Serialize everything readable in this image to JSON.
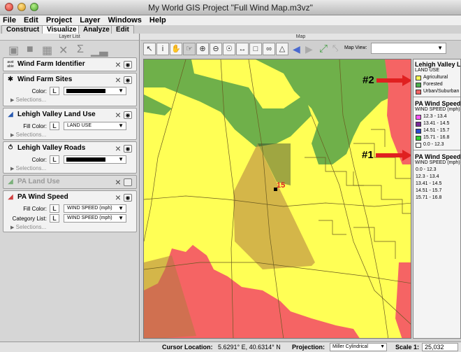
{
  "window": {
    "title": "My World GIS Project \"Full Wind Map.m3vz\""
  },
  "menu": [
    "File",
    "Edit",
    "Project",
    "Layer",
    "Windows",
    "Help"
  ],
  "tabs": [
    {
      "label": "Construct",
      "active": false
    },
    {
      "label": "Visualize",
      "active": true
    },
    {
      "label": "Analyze",
      "active": false
    },
    {
      "label": "Edit",
      "active": false
    }
  ],
  "layer_panel": {
    "title": "Layer List",
    "layers": [
      {
        "name": "Wind Farm Identifier",
        "icon_text": "avst abie"
      },
      {
        "name": "Wind Farm Sites",
        "color_label": "Color:",
        "selections": "Selections..."
      },
      {
        "name": "Lehigh Valley Land Use",
        "fill_label": "Fill Color:",
        "fill_value": "LAND USE",
        "selections": "Selections..."
      },
      {
        "name": "Lehigh Valley Roads",
        "color_label": "Color:",
        "selections": "Selections..."
      },
      {
        "name": "PA Land Use"
      },
      {
        "name": "PA Wind Speed",
        "fill_label": "Fill Color:",
        "fill_value": "WIND SPEED (mph)",
        "category_label": "Category List:",
        "category_value": "WIND SPEED (mph)",
        "selections": "Selections..."
      }
    ],
    "L_label": "L"
  },
  "map_panel": {
    "title": "Map",
    "map_view_label": "Map View:",
    "map_view_value": ""
  },
  "map": {
    "site_label": "15",
    "annotation_1": "#1",
    "annotation_2": "#2",
    "colors": {
      "yellow": "#ffff55",
      "green": "#6fb04a",
      "red": "#f56464",
      "brown": "#c89650",
      "arrow": "#e02020"
    }
  },
  "legend": {
    "land_use": {
      "title": "Lehigh Valley Land Use",
      "subtitle": "LAND USE",
      "items": [
        {
          "label": "Agricultural",
          "color": "#ffff55"
        },
        {
          "label": "Forested",
          "color": "#4caf4c"
        },
        {
          "label": "Urban/Suburban",
          "color": "#f56464"
        }
      ]
    },
    "wind_speed": {
      "title": "PA Wind Speed",
      "subtitle": "WIND SPEED (mph)",
      "items": [
        {
          "label": "12.3 - 13.4",
          "color": "#ff55ff"
        },
        {
          "label": "13.41 - 14.5",
          "color": "#7a2a9a"
        },
        {
          "label": "14.51 - 15.7",
          "color": "#2a4ad0"
        },
        {
          "label": "15.71 - 16.8",
          "color": "#30d030"
        },
        {
          "label": "0.0 - 12.3",
          "color": "#ffffff"
        }
      ]
    },
    "wind_speed_2": {
      "title": "PA Wind Speed",
      "subtitle": "WIND SPEED (mph)",
      "items": [
        "0.0 - 12.3",
        "12.3 - 13.4",
        "13.41 - 14.5",
        "14.51 - 15.7",
        "15.71 - 16.8"
      ]
    }
  },
  "status": {
    "cursor_label": "Cursor Location:",
    "cursor_value": "5.6291° E, 40.6314° N",
    "projection_label": "Projection:",
    "projection_value": "Miller Cylindrical",
    "scale_label": "Scale 1:",
    "scale_value": "25,032"
  }
}
